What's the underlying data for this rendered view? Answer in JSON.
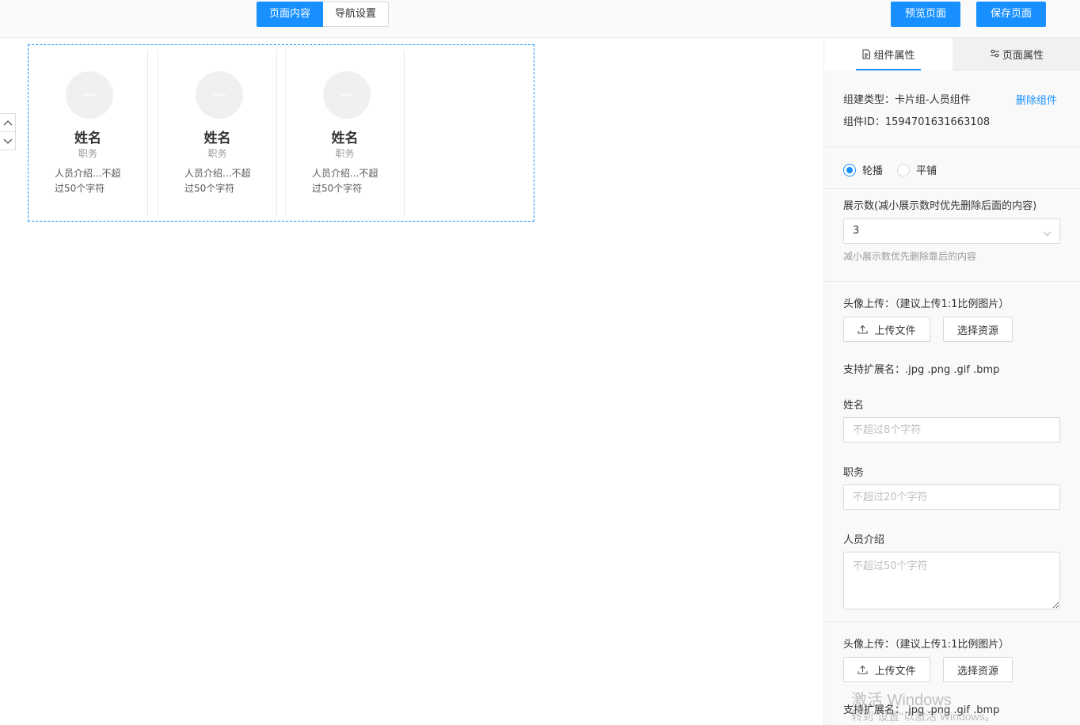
{
  "topbar": {
    "tabs": [
      "页面内容",
      "导航设置"
    ],
    "preview_label": "预览页面",
    "save_label": "保存页面"
  },
  "cards": [
    {
      "name": "姓名",
      "title": "职务",
      "desc": "人员介绍...不超过50个字符"
    },
    {
      "name": "姓名",
      "title": "职务",
      "desc": "人员介绍...不超过50个字符"
    },
    {
      "name": "姓名",
      "title": "职务",
      "desc": "人员介绍...不超过50个字符"
    }
  ],
  "panel": {
    "tabs": [
      "组件属性",
      "页面属性"
    ],
    "component_type": "组建类型：卡片组-人员组件",
    "delete_label": "删除组件",
    "component_id": "组件ID：1594701631663108",
    "mode_options": [
      "轮播",
      "平铺"
    ],
    "mode_selected": "轮播",
    "display_count_label": "展示数(减小展示数时优先删除后面的内容)",
    "display_count_value": "3",
    "display_count_hint": "减小展示数优先删除靠后的内容",
    "avatar_upload_label": "头像上传：（建议上传1:1比例图片）",
    "upload_file_label": "上传文件",
    "choose_resource_label": "选择资源",
    "supported_ext": "支持扩展名：.jpg .png .gif .bmp",
    "name_label": "姓名",
    "name_placeholder": "不超过8个字符",
    "title_label": "职务",
    "title_placeholder": "不超过20个字符",
    "intro_label": "人员介绍",
    "intro_placeholder": "不超过50个字符",
    "avatar_upload_label_2": "头像上传：（建议上传1:1比例图片）",
    "upload_file_label_2": "上传文件",
    "choose_resource_label_2": "选择资源",
    "supported_ext_2": "支持扩展名：.jpg .png .gif .bmp"
  },
  "watermark": {
    "line1": "激活 Windows",
    "line2": "转到\"设置\"以激活 Windows。"
  },
  "colors": {
    "primary": "#1890ff",
    "border": "#d9d9d9"
  }
}
